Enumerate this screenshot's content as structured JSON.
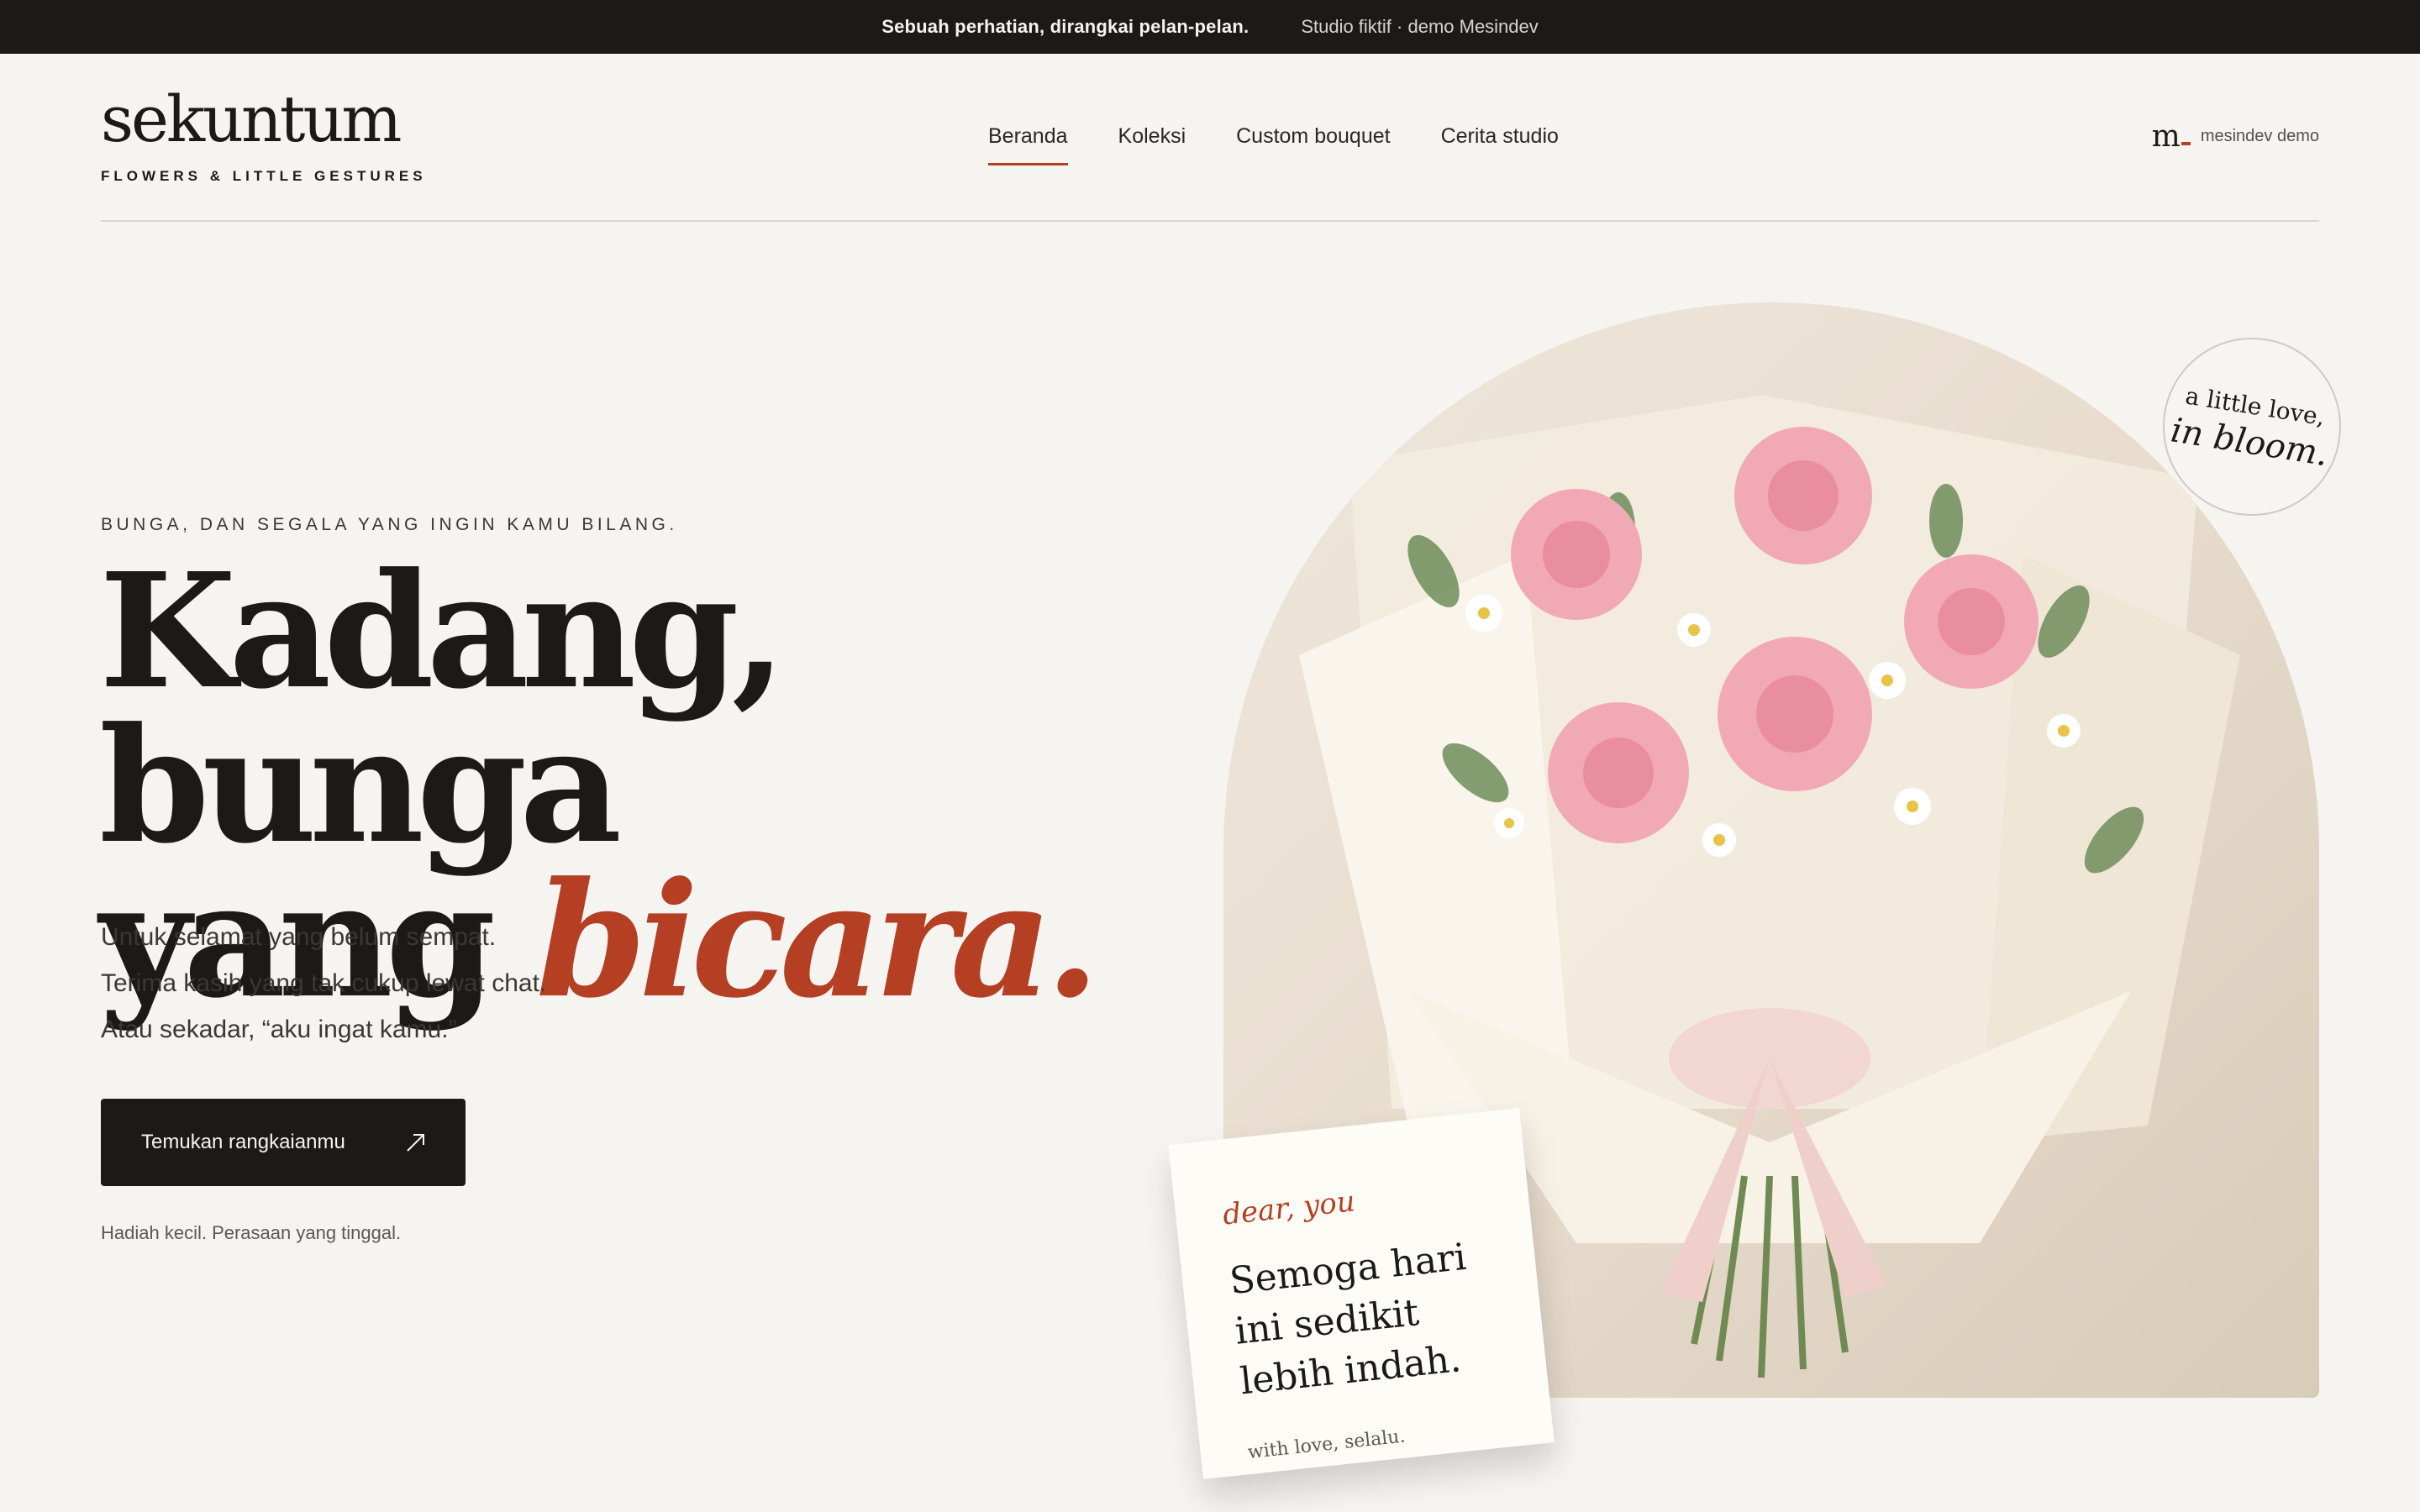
{
  "announcement": {
    "primary": "Sebuah perhatian, dirangkai pelan-pelan.",
    "secondary": "Studio fiktif · demo Mesindev"
  },
  "header": {
    "logo": "sekuntum",
    "tagline": "FLOWERS & LITTLE GESTURES",
    "nav": [
      {
        "label": "Beranda",
        "active": true
      },
      {
        "label": "Koleksi",
        "active": false
      },
      {
        "label": "Custom bouquet",
        "active": false
      },
      {
        "label": "Cerita studio",
        "active": false
      }
    ],
    "brand_mark": "m",
    "brand_label": "mesindev demo"
  },
  "hero": {
    "eyebrow": "BUNGA, DAN SEGALA YANG INGIN KAMU BILANG.",
    "headline_line1": "Kadang, bunga",
    "headline_line2_plain": "yang ",
    "headline_line2_accent": "bicara.",
    "subcopy": [
      "Untuk selamat yang belum sempat.",
      "Terima kasih yang tak cukup lewat chat.",
      "Atau sekadar, “aku ingat kamu.”"
    ],
    "cta_label": "Temukan rangkaianmu",
    "cta_icon": "arrow-up-right-icon",
    "footnote": "Hadiah kecil. Perasaan yang tinggal."
  },
  "image": {
    "subject": "bouquet-image"
  },
  "badge": {
    "line1": "a little love,",
    "line2": "in bloom."
  },
  "card": {
    "greeting": "dear, you",
    "message": "Semoga hari ini sedikit lebih indah.",
    "signature": "with love, selalu."
  },
  "colors": {
    "accent": "#b53f22",
    "ink": "#1b1a17",
    "background": "#f5f4f1"
  }
}
